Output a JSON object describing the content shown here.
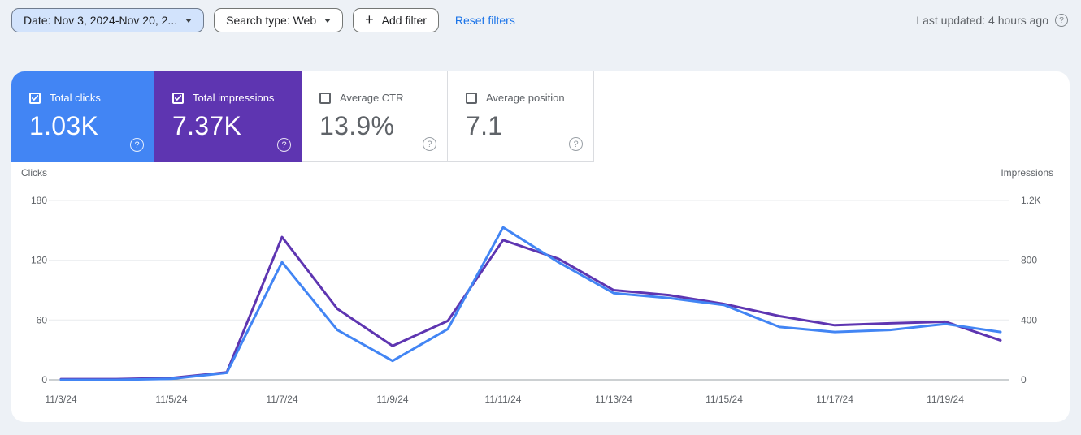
{
  "toolbar": {
    "date_filter": "Date: Nov 3, 2024-Nov 20, 2...",
    "search_type_filter": "Search type: Web",
    "add_filter_label": "Add filter",
    "reset_filters_label": "Reset filters",
    "last_updated": "Last updated: 4 hours ago"
  },
  "icons": {
    "help_glyph": "?",
    "plus_glyph": "+"
  },
  "metric_cards": [
    {
      "label": "Total clicks",
      "value": "1.03K",
      "checked": true,
      "color": "#4285f4"
    },
    {
      "label": "Total impressions",
      "value": "7.37K",
      "checked": true,
      "color": "#5e35b1"
    },
    {
      "label": "Average CTR",
      "value": "13.9%",
      "checked": false,
      "color": "#ffffff"
    },
    {
      "label": "Average position",
      "value": "7.1",
      "checked": false,
      "color": "#ffffff"
    }
  ],
  "colors": {
    "clicks_blue": "#4285f4",
    "impressions_purple": "#5e35b1",
    "link_blue": "#1a73e8",
    "background": "#edf1f6"
  },
  "chart_data": {
    "type": "line",
    "x": [
      "11/3/24",
      "11/4/24",
      "11/5/24",
      "11/6/24",
      "11/7/24",
      "11/8/24",
      "11/9/24",
      "11/10/24",
      "11/11/24",
      "11/12/24",
      "11/13/24",
      "11/14/24",
      "11/15/24",
      "11/16/24",
      "11/17/24",
      "11/18/24",
      "11/19/24",
      "11/20/24"
    ],
    "x_tick_every": 2,
    "series": [
      {
        "name": "Clicks",
        "axis": "left",
        "color": "#4285f4",
        "values": [
          0,
          0,
          1,
          7,
          118,
          50,
          19,
          51,
          153,
          118,
          87,
          82,
          75,
          53,
          48,
          50,
          56,
          48
        ]
      },
      {
        "name": "Impressions",
        "axis": "right",
        "color": "#5e35b1",
        "values": [
          5,
          5,
          12,
          50,
          955,
          475,
          227,
          394,
          935,
          810,
          600,
          567,
          507,
          426,
          365,
          378,
          389,
          264
        ]
      }
    ],
    "left_axis": {
      "title": "Clicks",
      "max": 180,
      "ticks": [
        {
          "label": "0",
          "value": 0
        },
        {
          "label": "60",
          "value": 60
        },
        {
          "label": "120",
          "value": 120
        },
        {
          "label": "180",
          "value": 180
        }
      ]
    },
    "right_axis": {
      "title": "Impressions",
      "max": 1200,
      "ticks": [
        {
          "label": "0",
          "value": 0
        },
        {
          "label": "400",
          "value": 400
        },
        {
          "label": "800",
          "value": 800
        },
        {
          "label": "1.2K",
          "value": 1200
        }
      ]
    },
    "grid": true,
    "legend_position": "none"
  }
}
